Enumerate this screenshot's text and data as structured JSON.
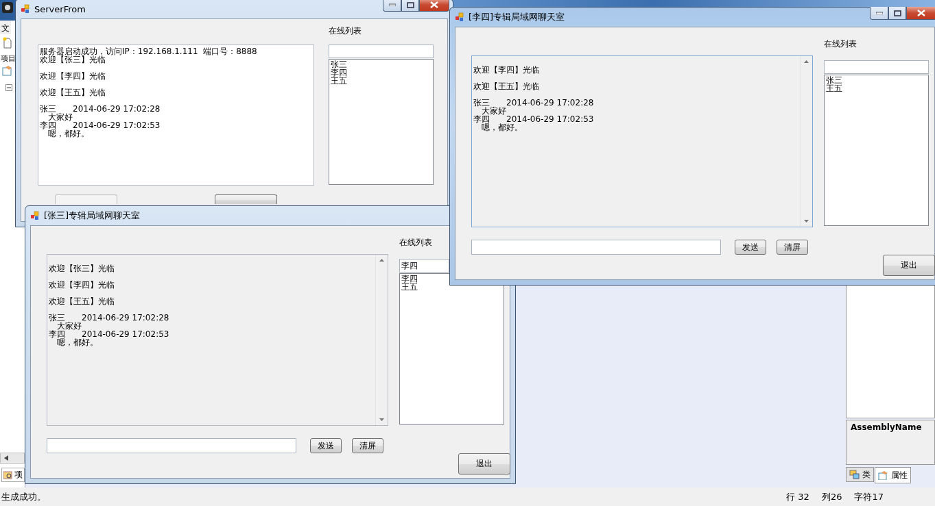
{
  "ide": {
    "menu_fragment": "文",
    "panel_fragment": "项目",
    "bottom_tab": "项",
    "properties": {
      "title": "AssemblyName"
    },
    "panel_tabs": [
      {
        "label": "类",
        "selected": false
      },
      {
        "label": "属性",
        "selected": true
      }
    ],
    "status_bar": {
      "message": "生成成功。",
      "line": "行 32",
      "column": "列26",
      "char": "字符17"
    }
  },
  "server_window": {
    "title": "ServerFrom",
    "active": false,
    "log": [
      {
        "kind": "status",
        "text": "服务器启动成功，访问IP：192.168.1.111  端口号：8888"
      },
      {
        "kind": "notice",
        "text": "欢迎【张三】光临"
      },
      {
        "kind": "notice",
        "text": "欢迎【李四】光临"
      },
      {
        "kind": "notice",
        "text": "欢迎【王五】光临"
      },
      {
        "kind": "message",
        "sender": "张三",
        "time": "2014-06-29 17:02:28",
        "text": "大家好"
      },
      {
        "kind": "message",
        "sender": "李四",
        "time": "2014-06-29 17:02:53",
        "text": "嗯，都好。"
      }
    ],
    "online_label": "在线列表",
    "online_list": [
      "张三",
      "李四",
      "王五"
    ],
    "buttons": [
      {
        "disabled": true
      },
      {
        "disabled": false
      }
    ]
  },
  "chat_windows": [
    {
      "title": "[张三]专辑局域网聊天室",
      "active": false,
      "log": [
        {
          "kind": "notice",
          "text": "欢迎【张三】光临"
        },
        {
          "kind": "notice",
          "text": "欢迎【李四】光临"
        },
        {
          "kind": "notice",
          "text": "欢迎【王五】光临"
        },
        {
          "kind": "message",
          "sender": "张三",
          "time": "2014-06-29 17:02:28",
          "text": "大家好"
        },
        {
          "kind": "message",
          "sender": "李四",
          "time": "2014-06-29 17:02:53",
          "text": "嗯，都好。"
        }
      ],
      "online_label": "在线列表",
      "user_field": {
        "value": "李四"
      },
      "online_list": [
        "李四",
        "王五"
      ],
      "send_button": "发送",
      "clear_button": "清屏",
      "exit_button": "退出"
    },
    {
      "title": "[李四]专辑局域网聊天室",
      "active": true,
      "log": [
        {
          "kind": "notice",
          "text": "欢迎【李四】光临"
        },
        {
          "kind": "notice",
          "text": "欢迎【王五】光临"
        },
        {
          "kind": "message",
          "sender": "张三",
          "time": "2014-06-29 17:02:28",
          "text": "大家好"
        },
        {
          "kind": "message",
          "sender": "李四",
          "time": "2014-06-29 17:02:53",
          "text": "嗯，都好。"
        }
      ],
      "online_label": "在线列表",
      "online_list": [
        "张三",
        "王五"
      ],
      "send_button": "发送",
      "clear_button": "清屏",
      "exit_button": "退出"
    }
  ]
}
